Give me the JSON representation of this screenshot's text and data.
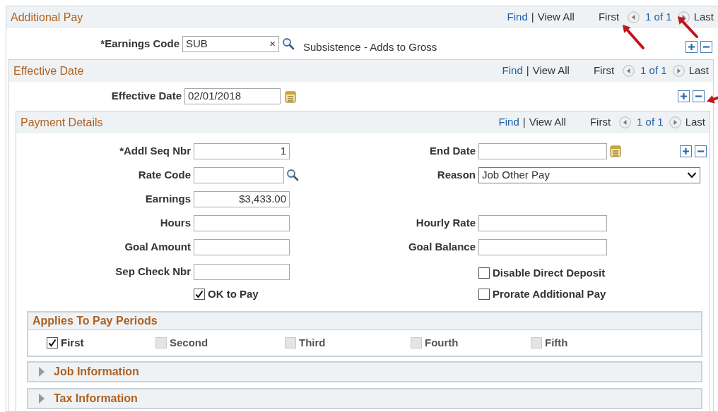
{
  "additional_pay": {
    "title": "Additional Pay",
    "nav": {
      "find": "Find",
      "separator": "|",
      "view_all": "View All",
      "first": "First",
      "position": "1 of 1",
      "last": "Last"
    },
    "earnings_code": {
      "label": "*Earnings Code",
      "value": "SUB",
      "clear": "×",
      "description": "Subsistence - Adds to Gross"
    }
  },
  "effective_date": {
    "title": "Effective Date",
    "nav": {
      "find": "Find",
      "separator": "|",
      "view_all": "View All",
      "first": "First",
      "position": "1 of 1",
      "last": "Last"
    },
    "field": {
      "label": "Effective Date",
      "value": "02/01/2018"
    }
  },
  "payment_details": {
    "title": "Payment Details",
    "nav": {
      "find": "Find",
      "separator": "|",
      "view_all": "View All",
      "first": "First",
      "position": "1 of 1",
      "last": "Last"
    },
    "rows": [
      {
        "left": {
          "kind": "number",
          "label": "*Addl Seq Nbr",
          "value": "1"
        },
        "right": {
          "kind": "date",
          "label": "End Date"
        },
        "row_buttons": true
      },
      {
        "left": {
          "kind": "lookup",
          "label": "Rate Code"
        },
        "right": {
          "kind": "select",
          "label": "Reason",
          "value": "Job Other Pay"
        }
      },
      {
        "left": {
          "kind": "number",
          "label": "Earnings",
          "value": "$3,433.00"
        }
      },
      {
        "left": {
          "kind": "text",
          "label": "Hours"
        },
        "right": {
          "kind": "text",
          "label": "Hourly Rate"
        }
      },
      {
        "left": {
          "kind": "text",
          "label": "Goal Amount"
        },
        "right": {
          "kind": "text",
          "label": "Goal Balance"
        }
      },
      {
        "left": {
          "kind": "text",
          "label": "Sep Check Nbr"
        },
        "right": {
          "kind": "checkbox",
          "label": "Disable Direct Deposit",
          "checked": false
        }
      },
      {
        "left": {
          "kind": "checkbox",
          "label": "OK to Pay",
          "checked": true
        },
        "right": {
          "kind": "checkbox",
          "label": "Prorate Additional Pay",
          "checked": false
        }
      }
    ],
    "pay_periods": {
      "title": "Applies To Pay Periods",
      "items": [
        {
          "label": "First",
          "checked": true,
          "disabled": false
        },
        {
          "label": "Second",
          "checked": false,
          "disabled": true
        },
        {
          "label": "Third",
          "checked": false,
          "disabled": true
        },
        {
          "label": "Fourth",
          "checked": false,
          "disabled": true
        },
        {
          "label": "Fifth",
          "checked": false,
          "disabled": true
        }
      ]
    },
    "sections": [
      {
        "title": "Job Information",
        "expanded": false
      },
      {
        "title": "Tax Information",
        "expanded": false
      }
    ]
  }
}
